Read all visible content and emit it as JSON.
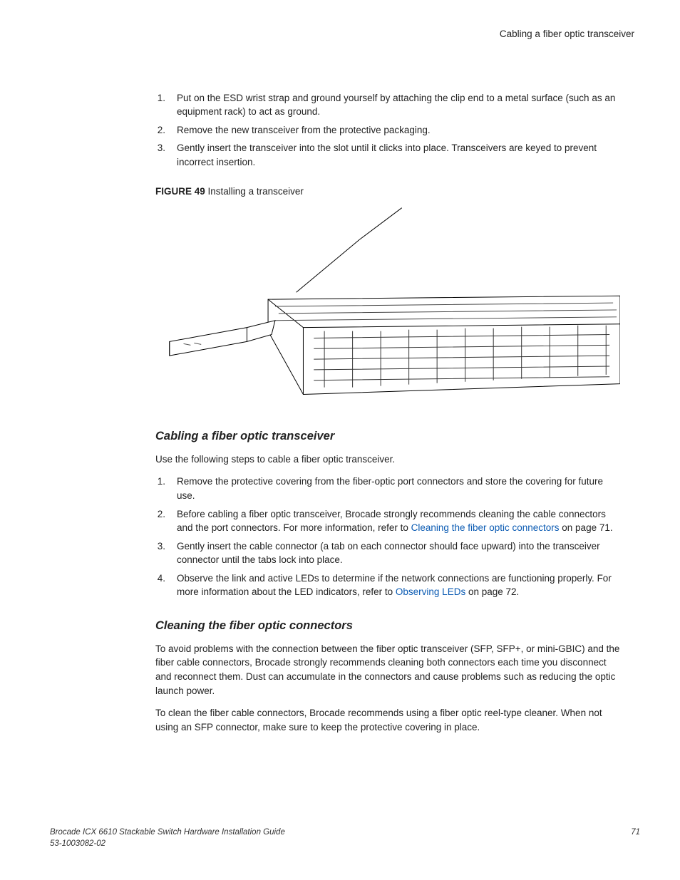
{
  "header": {
    "running_head": "Cabling a fiber optic transceiver"
  },
  "section1": {
    "steps": [
      {
        "n": "1.",
        "t": "Put on the ESD wrist strap and ground yourself by attaching the clip end to a metal surface (such as an equipment rack) to act as ground."
      },
      {
        "n": "2.",
        "t": "Remove the new transceiver from the protective packaging."
      },
      {
        "n": "3.",
        "t": "Gently insert the transceiver into the slot until it clicks into place. Transceivers are keyed to prevent incorrect insertion."
      }
    ],
    "figure_label_bold": "FIGURE 49",
    "figure_label_rest": " Installing a transceiver"
  },
  "section2": {
    "heading": "Cabling a fiber optic transceiver",
    "intro": "Use the following steps to cable a fiber optic transceiver.",
    "steps": [
      {
        "n": "1.",
        "t": "Remove the protective covering from the fiber-optic port connectors and store the covering for future use."
      },
      {
        "n": "2.",
        "t_a": "Before cabling a fiber optic transceiver, Brocade strongly recommends cleaning the cable connectors and the port connectors. For more information, refer to ",
        "link": "Cleaning the fiber optic connectors",
        "t_b": " on page 71."
      },
      {
        "n": "3.",
        "t": "Gently insert the cable connector (a tab on each connector should face upward) into the transceiver connector until the tabs lock into place."
      },
      {
        "n": "4.",
        "t_a": "Observe the link and active LEDs to determine if the network connections are functioning properly. For more information about the LED indicators, refer to ",
        "link": "Observing LEDs",
        "t_b": " on page 72."
      }
    ]
  },
  "section3": {
    "heading": "Cleaning the fiber optic connectors",
    "p1": "To avoid problems with the connection between the fiber optic transceiver (SFP, SFP+, or mini-GBIC) and the fiber cable connectors, Brocade strongly recommends cleaning both connectors each time you disconnect and reconnect them. Dust can accumulate in the connectors and cause problems such as reducing the optic launch power.",
    "p2": "To clean the fiber cable connectors, Brocade recommends using a fiber optic reel-type cleaner. When not using an SFP connector, make sure to keep the protective covering in place."
  },
  "footer": {
    "title": "Brocade ICX 6610 Stackable Switch Hardware Installation Guide",
    "docnum": "53-1003082-02",
    "page": "71"
  }
}
